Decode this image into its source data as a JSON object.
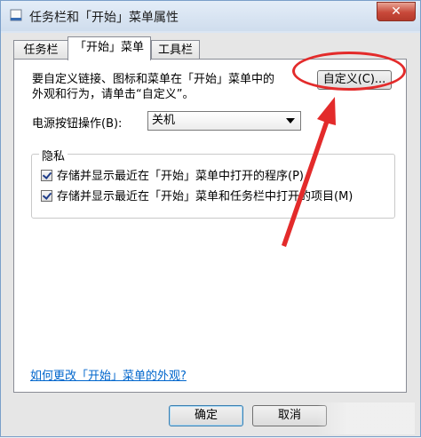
{
  "window": {
    "title": "任务栏和「开始」菜单属性",
    "close_label": "✕"
  },
  "tabs": [
    {
      "label": "任务栏",
      "active": false
    },
    {
      "label": "「开始」菜单",
      "active": true
    },
    {
      "label": "工具栏",
      "active": false
    }
  ],
  "start_menu": {
    "description_line1": "要自定义链接、图标和菜单在「开始」菜单中的",
    "description_line2": "外观和行为，请单击“自定义”。",
    "customize_button": "自定义(C)...",
    "power_label": "电源按钮操作(B):",
    "power_value": "关机"
  },
  "privacy": {
    "title": "隐私",
    "items": [
      {
        "label": "存储并显示最近在「开始」菜单中打开的程序(P)",
        "checked": true
      },
      {
        "label": "存储并显示最近在「开始」菜单和任务栏中打开的项目(M)",
        "checked": true
      }
    ]
  },
  "help_link": "如何更改「开始」菜单的外观?",
  "buttons": {
    "ok": "确定",
    "cancel": "取消"
  },
  "annotation": {
    "color": "#e32b2b"
  }
}
